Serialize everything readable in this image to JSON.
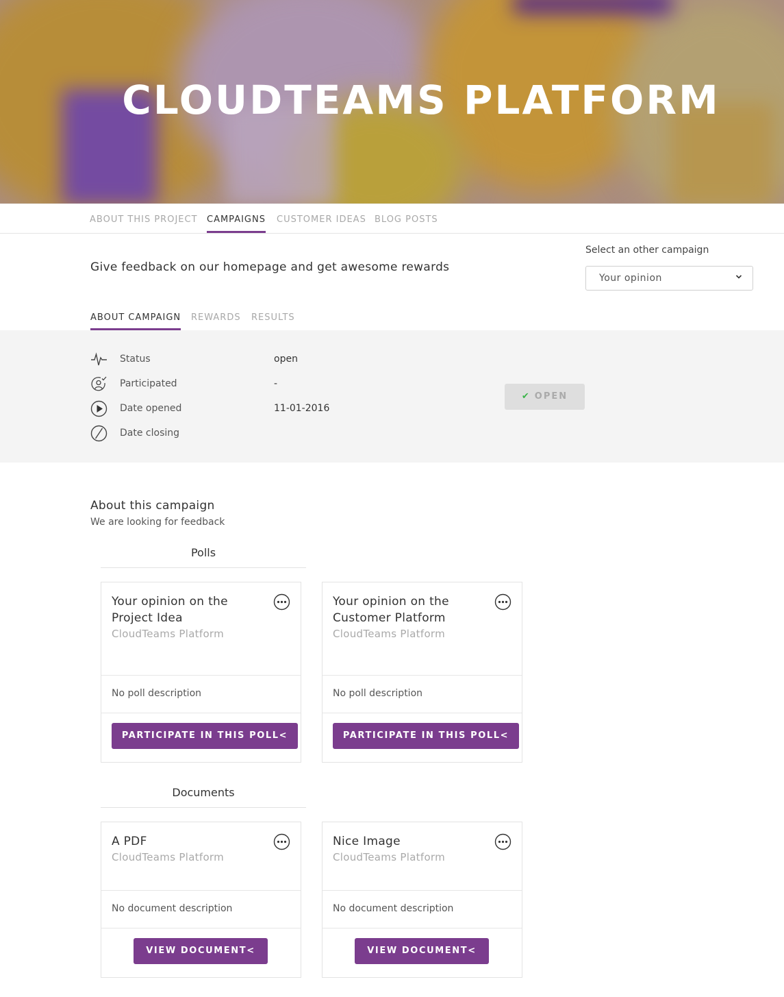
{
  "hero": {
    "title": "CLOUDTEAMS PLATFORM"
  },
  "main_tabs": [
    {
      "label": "ABOUT THIS PROJECT"
    },
    {
      "label": "CAMPAIGNS",
      "active": true
    },
    {
      "label": "CUSTOMER IDEAS"
    },
    {
      "label": "BLOG POSTS"
    }
  ],
  "campaign": {
    "heading": "Give feedback on our homepage and get awesome rewards",
    "select_label": "Select an other campaign",
    "select_value": "Your opinion"
  },
  "sub_tabs": [
    {
      "label": "ABOUT CAMPAIGN",
      "active": true
    },
    {
      "label": "REWARDS"
    },
    {
      "label": "RESULTS"
    }
  ],
  "info": {
    "rows": [
      {
        "icon": "pulse-icon",
        "label": "Status",
        "value": "open"
      },
      {
        "icon": "user-check-icon",
        "label": "Participated",
        "value": "-"
      },
      {
        "icon": "play-circle-icon",
        "label": "Date opened",
        "value": "11-01-2016"
      },
      {
        "icon": "ban-circle-icon",
        "label": "Date closing",
        "value": ""
      }
    ],
    "open_button": "OPEN"
  },
  "about": {
    "title": "About this campaign",
    "text": "We are looking for feedback"
  },
  "polls": {
    "section_title": "Polls",
    "items": [
      {
        "title": "Your opinion on the Project Idea",
        "subtitle": "CloudTeams Platform",
        "description": "No poll description",
        "button": "PARTICIPATE IN THIS POLL<"
      },
      {
        "title": "Your opinion on the Customer Platform",
        "subtitle": "CloudTeams Platform",
        "description": "No poll description",
        "button": "PARTICIPATE IN THIS POLL<"
      }
    ]
  },
  "documents": {
    "section_title": "Documents",
    "items": [
      {
        "title": "A PDF",
        "subtitle": "CloudTeams Platform",
        "description": "No document description",
        "button": "VIEW DOCUMENT<"
      },
      {
        "title": "Nice Image",
        "subtitle": "CloudTeams Platform",
        "description": "No document description",
        "button": "VIEW DOCUMENT<"
      }
    ]
  },
  "colors": {
    "accent": "#7b3d8e",
    "panel": "#f4f4f4",
    "success": "#3cb54a"
  }
}
